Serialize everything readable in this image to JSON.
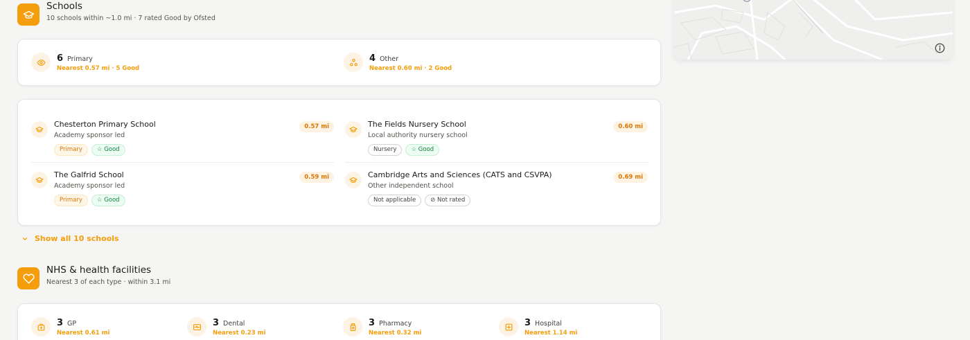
{
  "schools": {
    "title": "Schools",
    "subtitle": "10 schools within ~1.0 mi · 7 rated Good by Ofsted",
    "summary": [
      {
        "count": "6",
        "label": "Primary",
        "detail": "Nearest 0.57 mi · 5 Good",
        "icon": "eye-icon"
      },
      {
        "count": "4",
        "label": "Other",
        "detail": "Nearest 0.60 mi · 2 Good",
        "icon": "cluster-icon"
      }
    ],
    "list": [
      {
        "name": "Chesterton Primary School",
        "type": "Academy sponsor led",
        "distance": "0.57 mi",
        "phase": "Primary",
        "rating": "Good"
      },
      {
        "name": "The Fields Nursery School",
        "type": "Local authority nursery school",
        "distance": "0.60 mi",
        "phase": "Nursery",
        "rating": "Good"
      },
      {
        "name": "The Galfrid School",
        "type": "Academy sponsor led",
        "distance": "0.59 mi",
        "phase": "Primary",
        "rating": "Good"
      },
      {
        "name": "Cambridge Arts and Sciences (CATS and CSVPA)",
        "type": "Other independent school",
        "distance": "0.69 mi",
        "phase": "Not applicable",
        "rating": "Not rated"
      }
    ],
    "show_all": "Show all 10 schools"
  },
  "health": {
    "title": "NHS & health facilities",
    "subtitle": "Nearest 3 of each type · within 3.1 mi",
    "summary": [
      {
        "count": "3",
        "label": "GP",
        "detail": "Nearest 0.61 mi",
        "icon": "medical-bag-icon"
      },
      {
        "count": "3",
        "label": "Dental",
        "detail": "Nearest 0.23 mi",
        "icon": "monitor-pulse-icon"
      },
      {
        "count": "3",
        "label": "Pharmacy",
        "detail": "Nearest 0.32 mi",
        "icon": "pill-bottle-icon"
      },
      {
        "count": "3",
        "label": "Hospital",
        "detail": "Nearest 1.14 mi",
        "icon": "hospital-cross-icon"
      }
    ]
  },
  "colors": {
    "accent": "#f59e0b",
    "good": "#15803d",
    "primary_tag": "#d97706"
  }
}
